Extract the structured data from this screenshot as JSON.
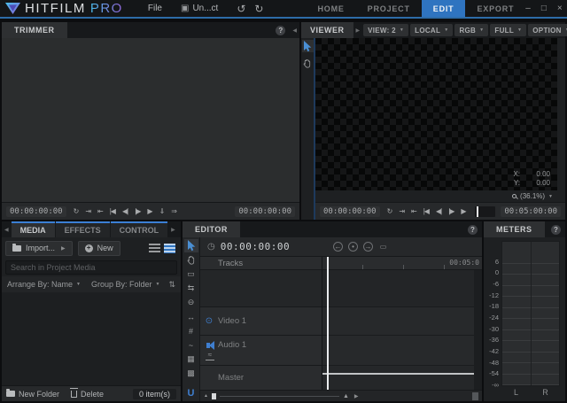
{
  "icons": {
    "caret": "▼",
    "help": "?",
    "save": "▣",
    "undo": "↺",
    "redo": "↻",
    "scroll_left": "◀",
    "scroll_right": "▶",
    "eye": "⊙",
    "clock": "◷",
    "sort": "⇅",
    "mixer": "≈",
    "tri": "▲",
    "arrow_right": "▶"
  },
  "titlebar": {
    "brand": "HITFILM",
    "edition": "PRO",
    "file_menu": "File",
    "project_name": "Un...ct",
    "min": "–",
    "max": "□",
    "close": "×",
    "nav_tabs": [
      {
        "name": "nav-tab-home",
        "label": "HOME"
      },
      {
        "name": "nav-tab-project",
        "label": "PROJECT"
      },
      {
        "name": "nav-tab-edit",
        "label": "EDIT",
        "active": true
      },
      {
        "name": "nav-tab-export",
        "label": "EXPORT"
      }
    ]
  },
  "trimmer": {
    "title": "TRIMMER",
    "transport": {
      "current": "00:00:00:00",
      "duration": "00:00:00:00",
      "icons": [
        {
          "name": "loop-icon",
          "glyph": "↻"
        },
        {
          "name": "out-point-icon",
          "glyph": "⇥"
        },
        {
          "name": "in-point-icon",
          "glyph": "⇤"
        },
        {
          "name": "prev-frame-icon",
          "glyph": "|◀"
        },
        {
          "name": "step-back-icon",
          "glyph": "◀|"
        },
        {
          "name": "step-forward-icon",
          "glyph": "|▶"
        },
        {
          "name": "play-icon",
          "glyph": "▶"
        },
        {
          "name": "insert-icon",
          "glyph": "⇓"
        },
        {
          "name": "overwrite-icon",
          "glyph": "⇒"
        }
      ]
    }
  },
  "viewer": {
    "title": "VIEWER",
    "dropdowns": [
      {
        "name": "view-mode-dropdown",
        "label": "VIEW: 2"
      },
      {
        "name": "space-dropdown",
        "label": "LOCAL"
      },
      {
        "name": "channels-dropdown",
        "label": "RGB"
      },
      {
        "name": "quality-dropdown",
        "label": "FULL"
      },
      {
        "name": "options-dropdown",
        "label": "OPTION"
      }
    ],
    "overlay": {
      "x_label": "X:",
      "x_value": "0.00",
      "y_label": "Y:",
      "y_value": "0.00"
    },
    "zoom_value": "(36.1%)",
    "transport": {
      "current": "00:00:00:00",
      "duration": "00:05:00:00",
      "icons": [
        {
          "name": "loop-icon",
          "glyph": "↻"
        },
        {
          "name": "out-point-icon",
          "glyph": "⇥"
        },
        {
          "name": "in-point-icon",
          "glyph": "⇤"
        },
        {
          "name": "prev-frame-icon",
          "glyph": "|◀"
        },
        {
          "name": "step-back-icon",
          "glyph": "◀|"
        },
        {
          "name": "step-forward-icon",
          "glyph": "|▶"
        },
        {
          "name": "play-icon",
          "glyph": "▶"
        }
      ]
    }
  },
  "media": {
    "tabs": [
      {
        "name": "tab-media",
        "label": "MEDIA",
        "active": true
      },
      {
        "name": "tab-effects",
        "label": "EFFECTS"
      },
      {
        "name": "tab-control",
        "label": "CONTROL"
      }
    ],
    "import_label": "Import...",
    "new_label": "New",
    "search_placeholder": "Search in Project Media",
    "arrange_by": "Arrange By: Name",
    "group_by": "Group By: Folder",
    "footer": {
      "new_folder": "New Folder",
      "delete_label": "Delete",
      "count": "0 item(s)"
    }
  },
  "editor": {
    "title": "EDITOR",
    "timecode": "00:00:00:00",
    "tracks_label": "Tracks",
    "ruler_end_label": "00:05:0",
    "header_buttons": [
      {
        "name": "jump-back-icon",
        "glyph": "←",
        "cls": "circ"
      },
      {
        "name": "snap-marker-icon",
        "glyph": "•",
        "cls": "circ"
      },
      {
        "name": "jump-forward-icon",
        "glyph": "→",
        "cls": "circ"
      },
      {
        "name": "slip-clip-icon",
        "glyph": "▭"
      }
    ],
    "tools": {
      "razor": "▭",
      "ripple": "⇆",
      "roll": "⊖",
      "slip": "↔",
      "slide": "#",
      "rate": "~",
      "frame": "▦",
      "strip": "▩",
      "snap": "U"
    },
    "tracks": [
      {
        "name": "Video 1"
      },
      {
        "name": "Audio 1"
      },
      {
        "name": "Master"
      }
    ]
  },
  "meters": {
    "title": "METERS",
    "scale": [
      "6",
      "0",
      "-6",
      "-12",
      "-18",
      "-24",
      "-30",
      "-36",
      "-42",
      "-48",
      "-54",
      "-∞"
    ],
    "channels": [
      "L",
      "R"
    ]
  }
}
